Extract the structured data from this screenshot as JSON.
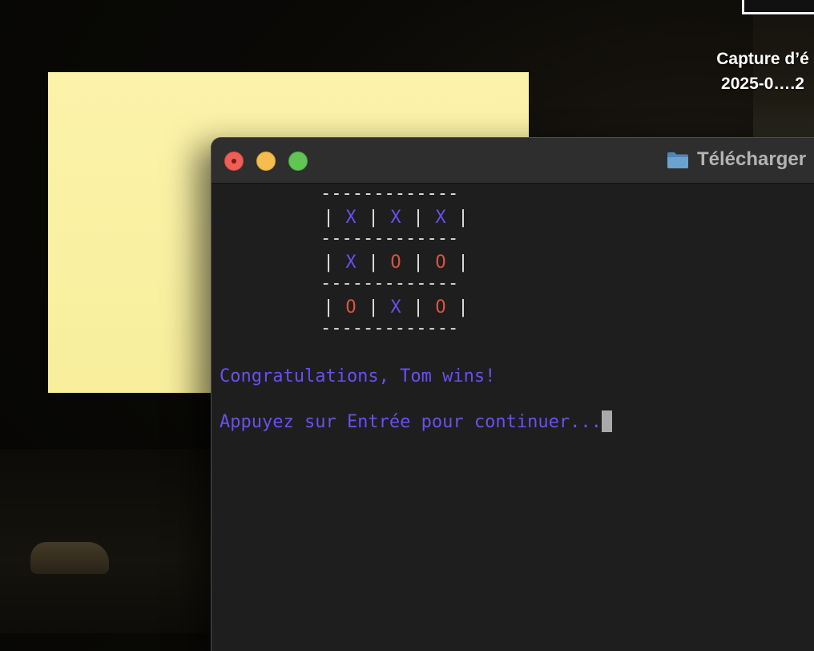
{
  "desktop": {
    "file_label_line1": "Capture d’é",
    "file_label_line2": "2025-0….2"
  },
  "window": {
    "title": "Télécharger",
    "folder_icon": "folder-icon",
    "colors": {
      "background": "#1e1e1e",
      "titlebar": "#2e2e2e",
      "close": "#ee5f57",
      "minimize": "#f5bd4f",
      "zoom": "#61c554"
    }
  },
  "terminal": {
    "separator": "-------------",
    "bar": "|",
    "board": [
      [
        "X",
        "X",
        "X"
      ],
      [
        "X",
        "O",
        "O"
      ],
      [
        "O",
        "X",
        "O"
      ]
    ],
    "message": "Congratulations, Tom wins!",
    "prompt": "Appuyez sur Entrée pour continuer...",
    "colors": {
      "x": "#6a4ff0",
      "o": "#d8553f",
      "grid": "#e6e6e6",
      "message": "#6a4ff0"
    }
  }
}
